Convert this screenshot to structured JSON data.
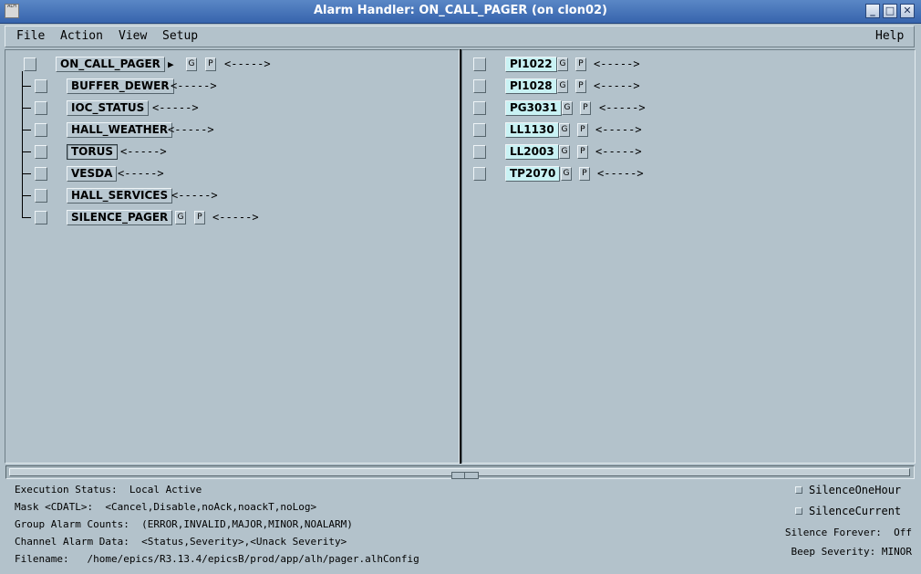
{
  "window": {
    "title": "Alarm Handler: ON_CALL_PAGER (on clon02)",
    "icon_label": "ALH",
    "controls": {
      "minimize": "_",
      "maximize": "□",
      "close": "✕"
    }
  },
  "menubar": {
    "file": "File",
    "action": "Action",
    "view": "View",
    "setup": "Setup",
    "help": "Help"
  },
  "tree": {
    "root": {
      "name": "ON_CALL_PAGER",
      "g": "G",
      "p": "P",
      "arrow": "<----->",
      "expand_glyph": "▶"
    },
    "groups": [
      {
        "name": "BUFFER_DEWER",
        "arrow": "<----->"
      },
      {
        "name": "IOC_STATUS",
        "arrow": "<----->"
      },
      {
        "name": "HALL_WEATHER",
        "arrow": "<----->"
      },
      {
        "name": "TORUS",
        "arrow": "<----->"
      },
      {
        "name": "VESDA",
        "arrow": "<----->"
      },
      {
        "name": "HALL_SERVICES",
        "arrow": "<----->"
      },
      {
        "name": "SILENCE_PAGER",
        "g": "G",
        "p": "P",
        "arrow": "<----->"
      }
    ]
  },
  "channels": [
    {
      "name": "PI1022",
      "g": "G",
      "p": "P",
      "arrow": "<----->"
    },
    {
      "name": "PI1028",
      "g": "G",
      "p": "P",
      "arrow": "<----->"
    },
    {
      "name": "PG3031",
      "g": "G",
      "p": "P",
      "arrow": "<----->"
    },
    {
      "name": "LL1130",
      "g": "G",
      "p": "P",
      "arrow": "<----->"
    },
    {
      "name": "LL2003",
      "g": "G",
      "p": "P",
      "arrow": "<----->"
    },
    {
      "name": "TP2070",
      "g": "G",
      "p": "P",
      "arrow": "<----->"
    }
  ],
  "status": {
    "execution": "Execution Status:  Local Active",
    "mask": "Mask <CDATL>:  <Cancel,Disable,noAck,noackT,noLog>",
    "group_counts": "Group Alarm Counts:  (ERROR,INVALID,MAJOR,MINOR,NOALARM)",
    "channel_data": "Channel Alarm Data:  <Status,Severity>,<Unack Severity>",
    "filename": "Filename:   /home/epics/R3.13.4/epicsB/prod/app/alh/pager.alhConfig"
  },
  "silence": {
    "one_hour": "SilenceOneHour",
    "current": "SilenceCurrent",
    "forever": "Silence Forever:  Off",
    "beep": "Beep Severity: MINOR"
  },
  "colors": {
    "background": "#b3c2cb",
    "titlebar": "#3f6db2",
    "channel_button": "#c9f2f4"
  }
}
